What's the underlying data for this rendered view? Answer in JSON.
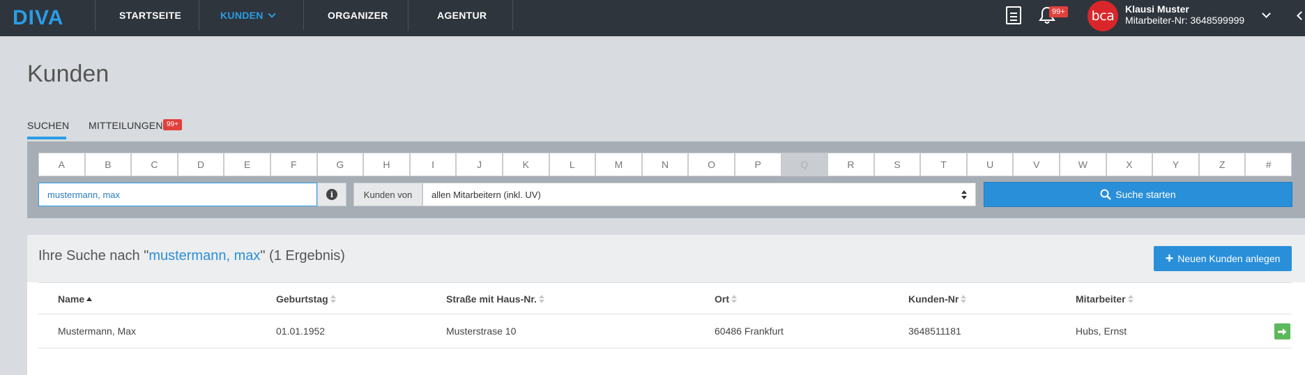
{
  "app": {
    "logo": "DIVA"
  },
  "nav": {
    "items": [
      {
        "label": "STARTSEITE"
      },
      {
        "label": "KUNDEN",
        "active": true
      },
      {
        "label": "ORGANIZER"
      },
      {
        "label": "AGENTUR"
      }
    ],
    "notifications_badge": "99+",
    "user": {
      "avatar_text": "bca",
      "name": "Klausi Muster",
      "employee_id": "Mitarbeiter-Nr: 3648599999"
    }
  },
  "page": {
    "title": "Kunden"
  },
  "tabs": [
    {
      "label": "SUCHEN",
      "active": true
    },
    {
      "label": "MITTEILUNGEN",
      "badge": "99+"
    }
  ],
  "search": {
    "alphabet": [
      "A",
      "B",
      "C",
      "D",
      "E",
      "F",
      "G",
      "H",
      "I",
      "J",
      "K",
      "L",
      "M",
      "N",
      "O",
      "P",
      "Q",
      "R",
      "S",
      "T",
      "U",
      "V",
      "W",
      "X",
      "Y",
      "Z",
      "#"
    ],
    "disabled_letters": [
      "Q"
    ],
    "query_value": "mustermann, max",
    "scope_label": "Kunden von",
    "scope_selected": "allen Mitarbeitern (inkl. UV)",
    "submit_label": "Suche starten"
  },
  "results": {
    "title_prefix": "Ihre Suche nach \"",
    "query": "mustermann, max",
    "title_suffix": "\" (1 Ergebnis)",
    "new_customer_label": "Neuen Kunden anlegen",
    "columns": [
      "Name",
      "Geburtstag",
      "Straße mit Haus-Nr.",
      "Ort",
      "Kunden-Nr",
      "Mitarbeiter"
    ],
    "sorted_column": "Name",
    "rows": [
      {
        "name": "Mustermann, Max",
        "birthday": "01.01.1952",
        "street": "Musterstrase 10",
        "city": "60486 Frankfurt",
        "customer_no": "3648511181",
        "employee": "Hubs, Ernst"
      }
    ]
  },
  "colors": {
    "nav_bg": "#2e353d",
    "accent": "#2a9ce6",
    "badge": "#e2403b",
    "success": "#5cb85c",
    "avatar": "#d9262a"
  }
}
